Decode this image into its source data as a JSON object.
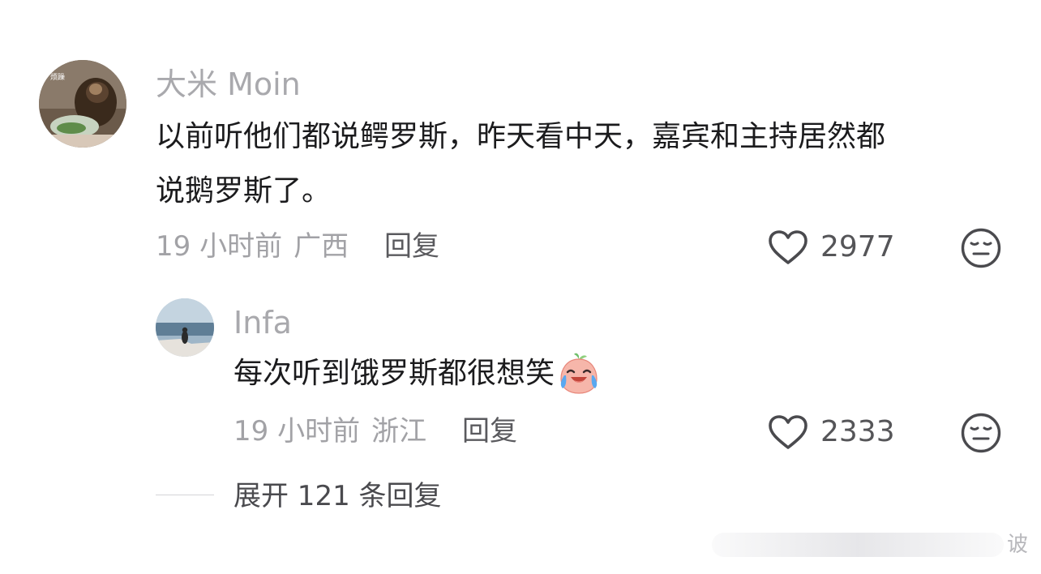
{
  "comments": [
    {
      "username": "大米 Moin",
      "text_line1": "以前听他们都说鳄罗斯，昨天看中天，嘉宾和主持居然都",
      "text_line2": "说鹅罗斯了。",
      "time": "19 小时前",
      "location": "广西",
      "reply_label": "回复",
      "likes": "2977"
    },
    {
      "username": "Infa",
      "text": "每次听到饿罗斯都很想笑",
      "emoji": "laugh-cry-peach",
      "time": "19 小时前",
      "location": "浙江",
      "reply_label": "回复",
      "likes": "2333"
    }
  ],
  "expand_replies_label": "展开 121 条回复",
  "watermark_text": "诐",
  "colors": {
    "username": "#a9a9ad",
    "content": "#1b1b1d",
    "meta": "#a2a2a6",
    "icon": "#4a4a4e"
  },
  "icons": [
    "heart-outline-icon",
    "dislike-face-icon"
  ]
}
